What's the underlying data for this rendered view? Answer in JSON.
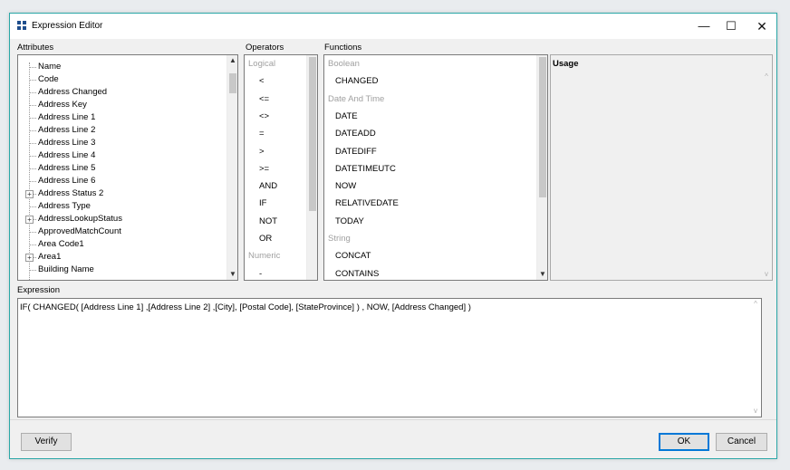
{
  "window": {
    "title": "Expression Editor",
    "min_glyph": "—",
    "max_glyph": "☐",
    "close_glyph": "✕"
  },
  "attributes": {
    "label": "Attributes",
    "items": [
      {
        "label": "Name",
        "expandable": false
      },
      {
        "label": "Code",
        "expandable": false
      },
      {
        "label": "Address Changed",
        "expandable": false
      },
      {
        "label": "Address Key",
        "expandable": false
      },
      {
        "label": "Address Line 1",
        "expandable": false
      },
      {
        "label": "Address Line 2",
        "expandable": false
      },
      {
        "label": "Address Line 3",
        "expandable": false
      },
      {
        "label": "Address Line 4",
        "expandable": false
      },
      {
        "label": "Address Line 5",
        "expandable": false
      },
      {
        "label": "Address Line 6",
        "expandable": false
      },
      {
        "label": "Address Status 2",
        "expandable": true
      },
      {
        "label": "Address Type",
        "expandable": false
      },
      {
        "label": "AddressLookupStatus",
        "expandable": true
      },
      {
        "label": "ApprovedMatchCount",
        "expandable": false
      },
      {
        "label": "Area Code1",
        "expandable": false
      },
      {
        "label": "Area1",
        "expandable": true
      },
      {
        "label": "Building Name",
        "expandable": false
      }
    ],
    "expander_glyph": "+"
  },
  "operators": {
    "label": "Operators",
    "rows": [
      {
        "text": "Logical",
        "kind": "cat"
      },
      {
        "text": "<",
        "kind": "op"
      },
      {
        "text": "<=",
        "kind": "op"
      },
      {
        "text": "<>",
        "kind": "op"
      },
      {
        "text": "=",
        "kind": "op"
      },
      {
        "text": ">",
        "kind": "op"
      },
      {
        "text": ">=",
        "kind": "op"
      },
      {
        "text": "AND",
        "kind": "op"
      },
      {
        "text": "IF",
        "kind": "op"
      },
      {
        "text": "NOT",
        "kind": "op"
      },
      {
        "text": "OR",
        "kind": "op"
      },
      {
        "text": "Numeric",
        "kind": "cat"
      },
      {
        "text": "-",
        "kind": "op"
      }
    ]
  },
  "functions": {
    "label": "Functions",
    "rows": [
      {
        "text": "Boolean",
        "kind": "cat"
      },
      {
        "text": "CHANGED",
        "kind": "fn"
      },
      {
        "text": "Date And Time",
        "kind": "cat"
      },
      {
        "text": "DATE",
        "kind": "fn"
      },
      {
        "text": "DATEADD",
        "kind": "fn"
      },
      {
        "text": "DATEDIFF",
        "kind": "fn"
      },
      {
        "text": "DATETIMEUTC",
        "kind": "fn"
      },
      {
        "text": "NOW",
        "kind": "fn"
      },
      {
        "text": "RELATIVEDATE",
        "kind": "fn"
      },
      {
        "text": "TODAY",
        "kind": "fn"
      },
      {
        "text": "String",
        "kind": "cat"
      },
      {
        "text": "CONCAT",
        "kind": "fn"
      },
      {
        "text": "CONTAINS",
        "kind": "fn"
      }
    ]
  },
  "usage": {
    "label": "Usage"
  },
  "expression": {
    "label": "Expression",
    "value": "IF( CHANGED( [Address Line 1] ,[Address Line 2] ,[City], [Postal Code], [StateProvince] ) , NOW, [Address Changed]  )"
  },
  "buttons": {
    "verify": "Verify",
    "ok": "OK",
    "cancel": "Cancel"
  },
  "scroll_glyphs": {
    "up": "▲",
    "down": "▼",
    "up_thin": "^",
    "down_thin": "v"
  }
}
